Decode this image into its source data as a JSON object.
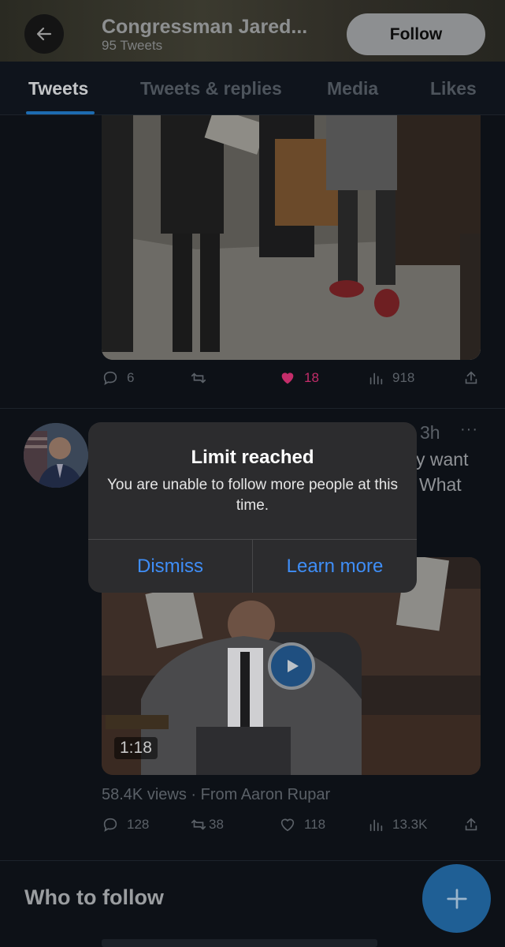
{
  "header": {
    "title": "Congressman Jared...",
    "subtitle": "95 Tweets",
    "follow_label": "Follow",
    "back_icon": "arrow-left-icon"
  },
  "tabs": [
    {
      "label": "Tweets",
      "active": true
    },
    {
      "label": "Tweets & replies",
      "active": false
    },
    {
      "label": "Media",
      "active": false
    },
    {
      "label": "Likes",
      "active": false
    }
  ],
  "tweet1": {
    "replies": "6",
    "retweets": "",
    "likes": "18",
    "views": "918",
    "like_color": "#c42d6a"
  },
  "tweet2": {
    "time": "3h",
    "more": "···",
    "text_line1": "y want",
    "text_line2": "What",
    "video_duration": "1:18",
    "views_source": "58.4K views · From Aaron Rupar",
    "replies": "128",
    "retweets": "38",
    "likes": "118",
    "views": "13.3K"
  },
  "who_to_follow": "Who to follow",
  "alert": {
    "title": "Limit reached",
    "message": "You are unable to follow more people at this time.",
    "dismiss_label": "Dismiss",
    "learn_more_label": "Learn more",
    "button_color": "#3f8ef7"
  },
  "fab_icon": "plus-icon"
}
